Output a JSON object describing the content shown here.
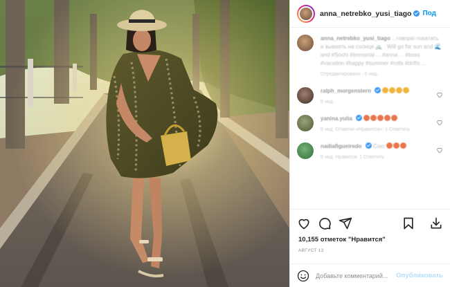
{
  "post": {
    "author": "anna_netrebko_yusi_tiago",
    "follow_label": "Под",
    "photo_alt": ""
  },
  "comments": [
    {
      "user": "anna_netrebko_yusi_tiago",
      "text": "...говорю покатать и вываять на солнце 🚲 . Will go for sun and 🌊 and #Sochi #Immortal ... #anna ... #boss #vacation #happy #summer #rolls #drifts ...",
      "meta": "Отредактировано · 6 нед.",
      "emoji_count": 0
    },
    {
      "user": "ralph_morgenstern",
      "text": "",
      "meta": "6 нед.",
      "emoji_count": 4
    },
    {
      "user": "yanina.yulia",
      "text": "",
      "meta": "6 нед.  Отметки «Нравится»: 1  Ответить",
      "emoji_count": 5
    },
    {
      "user": "nadiafigueiredo",
      "text": "Ciao",
      "meta": "6 нед.  Нравится: 1  Ответить",
      "emoji_count": 3
    }
  ],
  "icons": {
    "like": "heart-icon",
    "comment": "comment-icon",
    "share": "share-icon",
    "save": "bookmark-icon",
    "download": "download-icon",
    "emoji": "smile-icon"
  },
  "likes_text": "10,155 отметок \"Нравится\"",
  "date_text": "АВГУСТ 13",
  "comment_box": {
    "placeholder": "Добавьте комментарий...",
    "publish_label": "Опубликовать"
  },
  "colors": {
    "accent": "#0095f6",
    "publish_disabled": "#b2dffc",
    "verified": "#3897f0",
    "text": "#262626",
    "muted": "#8e8e8e"
  }
}
